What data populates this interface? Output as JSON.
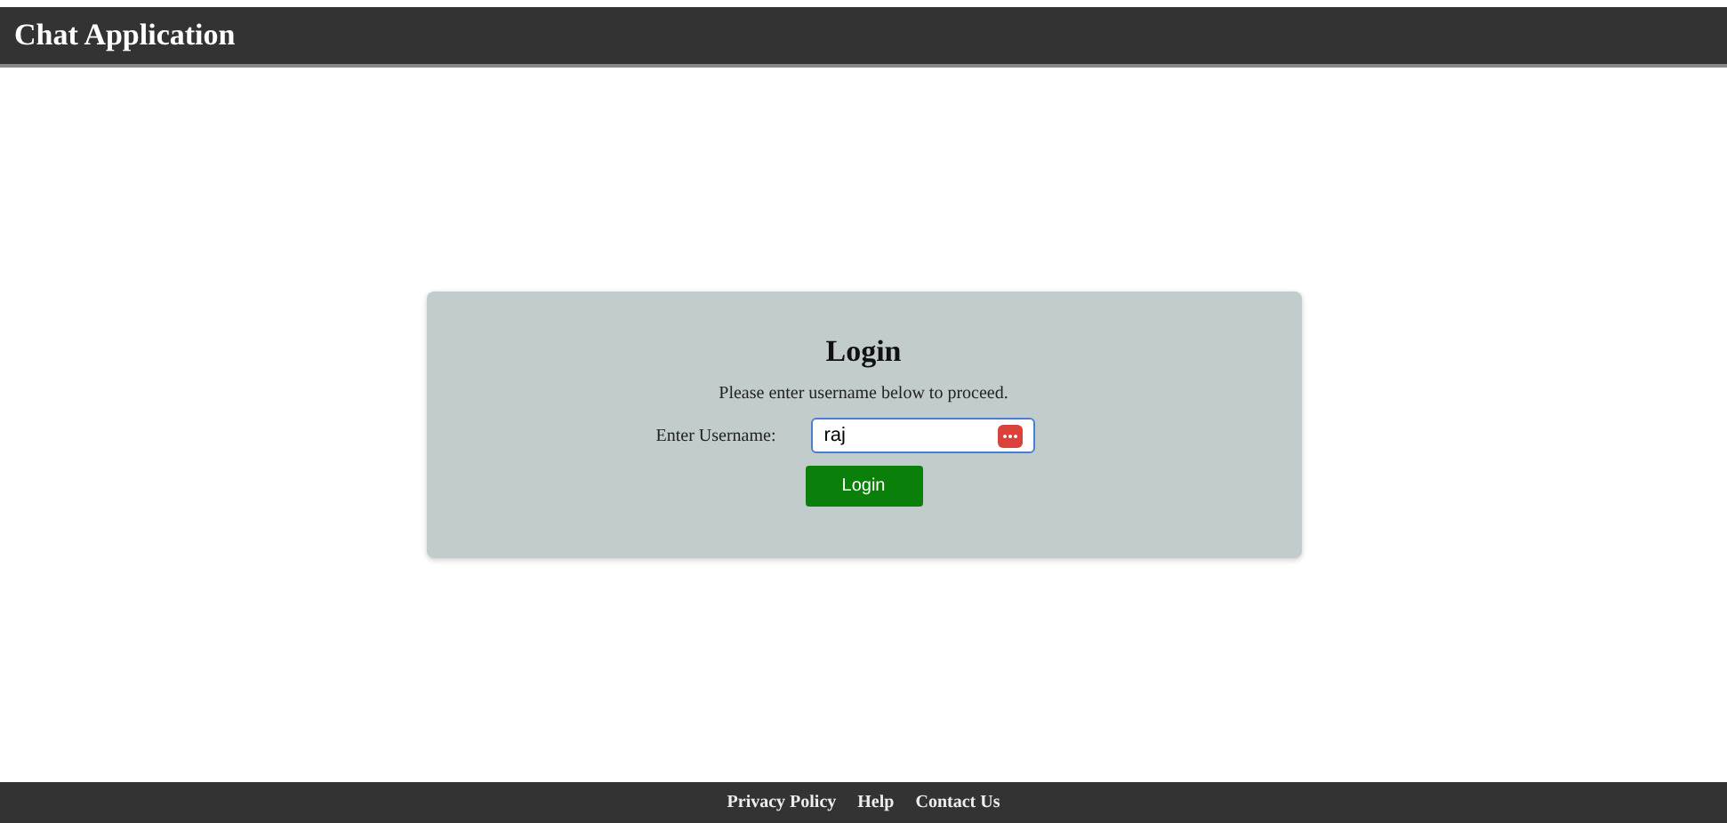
{
  "header": {
    "title": "Chat Application"
  },
  "login": {
    "title": "Login",
    "instruction": "Please enter username below to proceed.",
    "field_label": "Enter Username:",
    "username": {
      "value": "raj"
    },
    "button": "Login"
  },
  "footer": {
    "links": [
      "Privacy Policy",
      "Help",
      "Contact Us"
    ]
  }
}
